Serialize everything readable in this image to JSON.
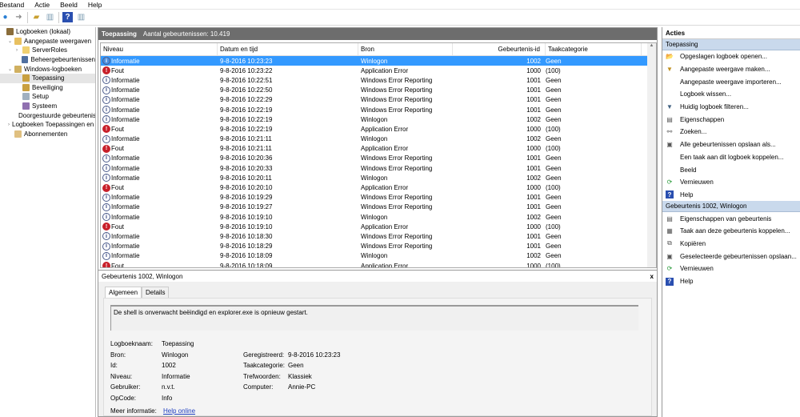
{
  "menu": [
    "Bestand",
    "Actie",
    "Beeld",
    "Help"
  ],
  "tree": [
    {
      "label": "Logboeken (lokaal)",
      "indent": 0,
      "icon": "computer-log-icon",
      "color": "#8a6d3b"
    },
    {
      "label": "Aangepaste weergaven",
      "indent": 1,
      "icon": "folder-icon",
      "color": "#e8c060"
    },
    {
      "label": "ServerRoles",
      "indent": 2,
      "icon": "folder-icon",
      "color": "#f0d070"
    },
    {
      "label": "Beheergebeurtenissen",
      "indent": 2,
      "icon": "filter-icon",
      "color": "#5070a0"
    },
    {
      "label": "Windows-logboeken",
      "indent": 1,
      "icon": "folder-log-icon",
      "color": "#d0b060"
    },
    {
      "label": "Toepassing",
      "indent": 2,
      "icon": "log-icon",
      "color": "#c9a040",
      "selected": true
    },
    {
      "label": "Beveiliging",
      "indent": 2,
      "icon": "log-icon",
      "color": "#c9a040"
    },
    {
      "label": "Setup",
      "indent": 2,
      "icon": "log-icon",
      "color": "#a0b0c0"
    },
    {
      "label": "Systeem",
      "indent": 2,
      "icon": "log-icon",
      "color": "#9070b0"
    },
    {
      "label": "Doorgestuurde gebeurtenissen",
      "indent": 2,
      "icon": "log-icon",
      "color": "#a0b0c0"
    },
    {
      "label": "Logboeken Toepassingen en services",
      "indent": 1,
      "icon": "folder-icon",
      "color": "#e8c060"
    },
    {
      "label": "Abonnementen",
      "indent": 1,
      "icon": "subscription-icon",
      "color": "#e0c080"
    }
  ],
  "header": {
    "title": "Toepassing",
    "count": "Aantal gebeurtenissen: 10.419"
  },
  "columns": [
    "Niveau",
    "Datum en tijd",
    "Bron",
    "Gebeurtenis-id",
    "Taakcategorie"
  ],
  "rows": [
    [
      "Informatie",
      "9-8-2016 10:23:23",
      "Winlogon",
      "1002",
      "Geen"
    ],
    [
      "Fout",
      "9-8-2016 10:23:22",
      "Application Error",
      "1000",
      "(100)"
    ],
    [
      "Informatie",
      "9-8-2016 10:22:51",
      "Windows Error Reporting",
      "1001",
      "Geen"
    ],
    [
      "Informatie",
      "9-8-2016 10:22:50",
      "Windows Error Reporting",
      "1001",
      "Geen"
    ],
    [
      "Informatie",
      "9-8-2016 10:22:29",
      "Windows Error Reporting",
      "1001",
      "Geen"
    ],
    [
      "Informatie",
      "9-8-2016 10:22:19",
      "Windows Error Reporting",
      "1001",
      "Geen"
    ],
    [
      "Informatie",
      "9-8-2016 10:22:19",
      "Winlogon",
      "1002",
      "Geen"
    ],
    [
      "Fout",
      "9-8-2016 10:22:19",
      "Application Error",
      "1000",
      "(100)"
    ],
    [
      "Informatie",
      "9-8-2016 10:21:11",
      "Winlogon",
      "1002",
      "Geen"
    ],
    [
      "Fout",
      "9-8-2016 10:21:11",
      "Application Error",
      "1000",
      "(100)"
    ],
    [
      "Informatie",
      "9-8-2016 10:20:36",
      "Windows Error Reporting",
      "1001",
      "Geen"
    ],
    [
      "Informatie",
      "9-8-2016 10:20:33",
      "Windows Error Reporting",
      "1001",
      "Geen"
    ],
    [
      "Informatie",
      "9-8-2016 10:20:11",
      "Winlogon",
      "1002",
      "Geen"
    ],
    [
      "Fout",
      "9-8-2016 10:20:10",
      "Application Error",
      "1000",
      "(100)"
    ],
    [
      "Informatie",
      "9-8-2016 10:19:29",
      "Windows Error Reporting",
      "1001",
      "Geen"
    ],
    [
      "Informatie",
      "9-8-2016 10:19:27",
      "Windows Error Reporting",
      "1001",
      "Geen"
    ],
    [
      "Informatie",
      "9-8-2016 10:19:10",
      "Winlogon",
      "1002",
      "Geen"
    ],
    [
      "Fout",
      "9-8-2016 10:19:10",
      "Application Error",
      "1000",
      "(100)"
    ],
    [
      "Informatie",
      "9-8-2016 10:18:30",
      "Windows Error Reporting",
      "1001",
      "Geen"
    ],
    [
      "Informatie",
      "9-8-2016 10:18:29",
      "Windows Error Reporting",
      "1001",
      "Geen"
    ],
    [
      "Informatie",
      "9-8-2016 10:18:09",
      "Winlogon",
      "1002",
      "Geen"
    ],
    [
      "Fout",
      "9-8-2016 10:18:09",
      "Application Error",
      "1000",
      "(100)"
    ]
  ],
  "detail": {
    "title": "Gebeurtenis 1002, Winlogon",
    "close": "x",
    "tabs": [
      "Algemeen",
      "Details"
    ],
    "message": "De shell is onverwacht beëindigd en explorer.exe is opnieuw gestart.",
    "left": [
      [
        "Logboeknaam:",
        "Toepassing"
      ],
      [
        "Bron:",
        "Winlogon"
      ],
      [
        "Id:",
        "1002"
      ],
      [
        "Niveau:",
        "Informatie"
      ],
      [
        "Gebruiker:",
        "n.v.t."
      ],
      [
        "OpCode:",
        "Info"
      ]
    ],
    "right": [
      [
        "Geregistreerd:",
        "9-8-2016 10:23:23"
      ],
      [
        "Taakcategorie:",
        "Geen"
      ],
      [
        "Trefwoorden:",
        "Klassiek"
      ],
      [
        "Computer:",
        "Annie-PC"
      ]
    ],
    "more_label": "Meer informatie:",
    "more_link": "Help online"
  },
  "actions": {
    "title": "Acties",
    "sections": [
      {
        "title": "Toepassing",
        "items": [
          {
            "label": "Opgeslagen logboek openen...",
            "icon": "open-folder-icon",
            "glyph": "📂"
          },
          {
            "label": "Aangepaste weergave maken...",
            "icon": "filter-create-icon",
            "glyph": "▼"
          },
          {
            "label": "Aangepaste weergave importeren...",
            "icon": "",
            "glyph": ""
          },
          {
            "label": "Logboek wissen...",
            "icon": "",
            "glyph": ""
          },
          {
            "label": "Huidig logboek filteren...",
            "icon": "filter-icon",
            "glyph": "▼"
          },
          {
            "label": "Eigenschappen",
            "icon": "properties-icon",
            "glyph": "▤"
          },
          {
            "label": "Zoeken...",
            "icon": "binoculars-icon",
            "glyph": "⚯"
          },
          {
            "label": "Alle gebeurtenissen opslaan als...",
            "icon": "save-icon",
            "glyph": "▣"
          },
          {
            "label": "Een taak aan dit logboek koppelen...",
            "icon": "",
            "glyph": ""
          },
          {
            "label": "Beeld",
            "icon": "",
            "glyph": ""
          },
          {
            "label": "Vernieuwen",
            "icon": "refresh-icon",
            "glyph": "⟳"
          },
          {
            "label": "Help",
            "icon": "help-icon",
            "glyph": "?"
          }
        ]
      },
      {
        "title": "Gebeurtenis 1002, Winlogon",
        "items": [
          {
            "label": "Eigenschappen van gebeurtenis",
            "icon": "properties-icon",
            "glyph": "▤"
          },
          {
            "label": "Taak aan deze gebeurtenis koppelen...",
            "icon": "task-icon",
            "glyph": "▦"
          },
          {
            "label": "Kopiëren",
            "icon": "copy-icon",
            "glyph": "⧉"
          },
          {
            "label": "Geselecteerde gebeurtenissen opslaan...",
            "icon": "save-icon",
            "glyph": "▣"
          },
          {
            "label": "Vernieuwen",
            "icon": "refresh-icon",
            "glyph": "⟳"
          },
          {
            "label": "Help",
            "icon": "help-icon",
            "glyph": "?"
          }
        ]
      }
    ]
  }
}
